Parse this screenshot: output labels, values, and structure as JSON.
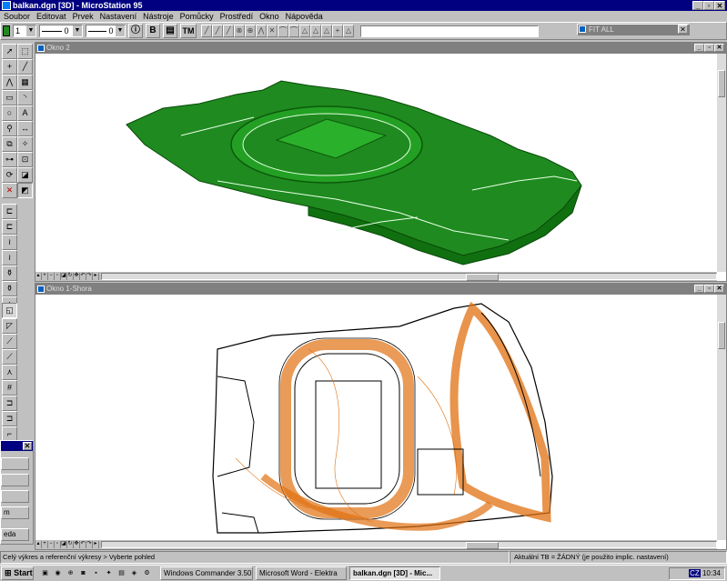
{
  "window": {
    "title": "balkan.dgn [3D] - MicroStation 95"
  },
  "menu": [
    "Soubor",
    "Editovat",
    "Prvek",
    "Nastavení",
    "Nástroje",
    "Pomůcky",
    "Prostředí",
    "Okno",
    "Nápověda"
  ],
  "toolbar": {
    "level_value": "1",
    "style_value": "0",
    "weight_value": "0",
    "info_btn": "ⓘ",
    "b_btn": "B",
    "tm_btn": "TM"
  },
  "fit_all": {
    "title": "FIT ALL"
  },
  "views": [
    {
      "title": "Okno 2"
    },
    {
      "title": "Okno 1-Shora"
    }
  ],
  "dialog_buttons": [
    "",
    "",
    "",
    "m",
    "eda"
  ],
  "status": {
    "left": "Celý výkres a referenční výkresy > Vyberte pohled",
    "right": "Aktuální TB = ŽÁDNÝ (je použito implic. nastavení)"
  },
  "taskbar": {
    "start": "Start",
    "tasks": [
      "Windows Commander 3.50...",
      "Microsoft Word - Elektra",
      "balkan.dgn [3D] - Mic..."
    ],
    "clock": "10:34"
  },
  "colors": {
    "title_active": "#000080",
    "title_inactive": "#808080",
    "model_green": "#1f8a1f",
    "contour_orange": "#e07010"
  }
}
